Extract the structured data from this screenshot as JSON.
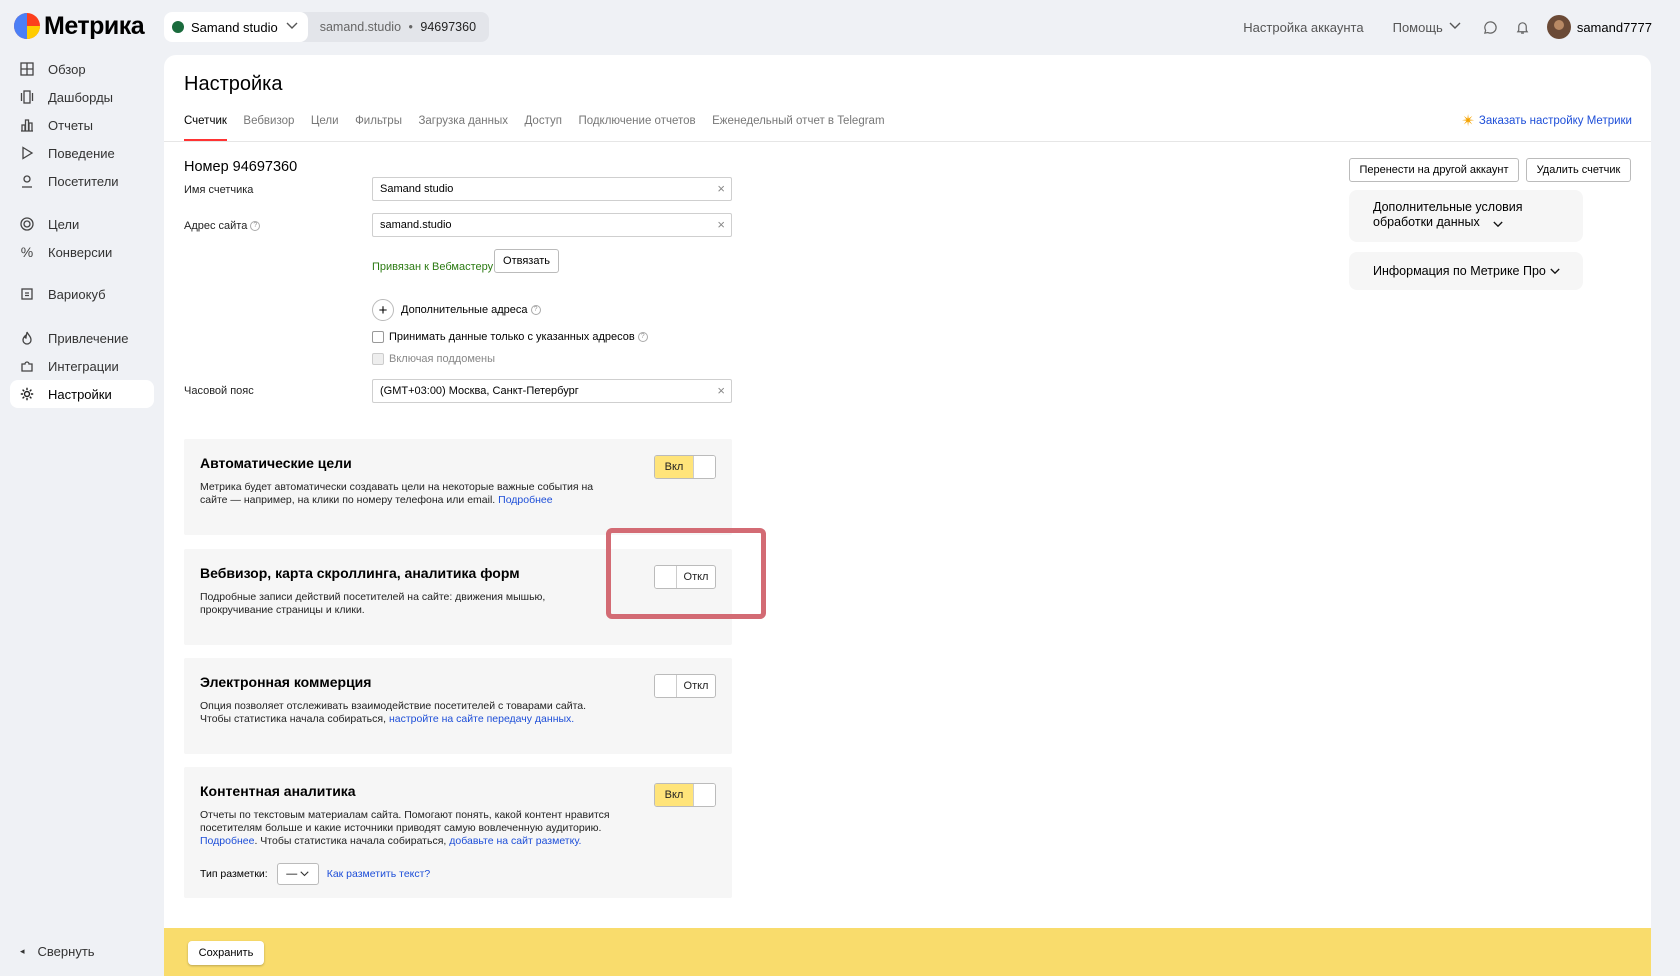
{
  "brand": {
    "name": "Метрика"
  },
  "counter": {
    "name": "Samand studio",
    "site": "samand.studio",
    "sep": "•",
    "id": "94697360"
  },
  "topnav": {
    "account_settings": "Настройка аккаунта",
    "help": "Помощь",
    "username": "samand7777"
  },
  "sidebar": {
    "items": [
      {
        "label": "Обзор",
        "icon": "grid-icon"
      },
      {
        "label": "Дашборды",
        "icon": "dashboard-icon"
      },
      {
        "label": "Отчеты",
        "icon": "reports-icon"
      },
      {
        "label": "Поведение",
        "icon": "play-icon"
      },
      {
        "label": "Посетители",
        "icon": "person-icon"
      },
      {
        "label": "Цели",
        "icon": "target-icon"
      },
      {
        "label": "Конверсии",
        "icon": "percent-icon"
      },
      {
        "label": "Вариокуб",
        "icon": "cube-icon"
      },
      {
        "label": "Привлечение",
        "icon": "flame-icon"
      },
      {
        "label": "Интеграции",
        "icon": "puzzle-icon"
      },
      {
        "label": "Настройки",
        "icon": "gear-icon",
        "active": true
      }
    ],
    "collapse": "Свернуть"
  },
  "page": {
    "title": "Настройка",
    "tabs": [
      "Счетчик",
      "Вебвизор",
      "Цели",
      "Фильтры",
      "Загрузка данных",
      "Доступ",
      "Подключение отчетов",
      "Еженедельный отчет в Telegram"
    ],
    "order_link": "Заказать настройку Метрики"
  },
  "form": {
    "number_title": "Номер 94697360",
    "name_label": "Имя счетчика",
    "name_value": "Samand studio",
    "site_label": "Адрес сайта",
    "site_value": "samand.studio",
    "webmaster_bound": "Привязан к Вебмастеру",
    "unbind": "Отвязать",
    "extra_addresses": "Дополнительные адреса",
    "only_listed": "Принимать данные только с указанных адресов",
    "subdomains": "Включая поддомены",
    "timezone_label": "Часовой пояс",
    "timezone_value": "(GMT+03:00) Москва, Санкт-Петербург"
  },
  "cards": [
    {
      "title": "Автоматические цели",
      "desc": "Метрика будет автоматически создавать цели на некоторые важные события на сайте — например, на клики по номеру телефона или email.",
      "link": "Подробнее",
      "toggle": "Вкл",
      "on": true
    },
    {
      "title": "Вебвизор, карта скроллинга, аналитика форм",
      "desc": "Подробные записи действий посетителей на сайте: движения мышью, прокручивание страницы и клики.",
      "toggle": "Откл",
      "on": false
    },
    {
      "title": "Электронная коммерция",
      "desc": "Опция позволяет отслеживать взаимодействие посетителей с товарами сайта. Чтобы статистика начала собираться,",
      "link": "настройте на сайте передачу данных.",
      "toggle": "Откл",
      "on": false
    },
    {
      "title": "Контентная аналитика",
      "desc": "Отчеты по текстовым материалам сайта. Помогают понять, какой контент нравится посетителям больше и какие источники приводят самую вовлеченную аудиторию.",
      "link1": "Подробнее",
      "mid": ". Чтобы статистика начала собираться,",
      "link2": "добавьте на сайт разметку.",
      "toggle": "Вкл",
      "on": true,
      "markup_label": "Тип разметки:",
      "markup_value": "—",
      "markup_link": "Как разметить текст?"
    }
  ],
  "right": {
    "move": "Перенести на другой аккаунт",
    "delete": "Удалить счетчик",
    "extra_terms": "Дополнительные условия обработки данных",
    "pro_info": "Информация по Метрике Про"
  },
  "footer": {
    "save": "Сохранить"
  }
}
